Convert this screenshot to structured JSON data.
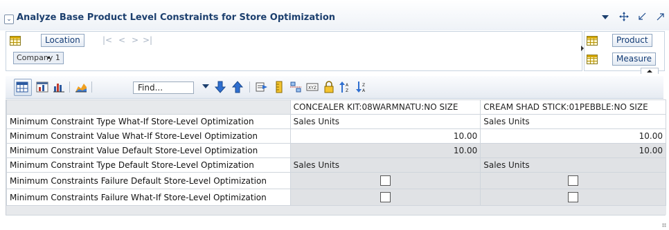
{
  "header": {
    "title": "Analyze Base Product Level Constraints for Store Optimization",
    "collapse_glyph": "⌄",
    "icons": [
      "dropdown-arrow-icon",
      "move-icon",
      "minimize-icon",
      "maximize-icon"
    ]
  },
  "pov": {
    "location_label": "Location",
    "nav_first": "|<",
    "nav_prev": "<",
    "nav_next": ">",
    "nav_last": ">|",
    "selected_member": "Company 1",
    "right_dims": [
      "Product",
      "Measure"
    ]
  },
  "toolbar": {
    "find_value": "Find...",
    "icons": [
      "spreadsheet-view-icon",
      "pivot-chart-icon",
      "bar-chart-icon",
      "area-chart-icon",
      "find-dropdown-icon",
      "find-next-icon",
      "find-previous-icon",
      "export-icon",
      "ruler-icon",
      "split-icon",
      "xyz-icon",
      "lock-icon",
      "sort-ascending-icon",
      "sort-descending-icon"
    ]
  },
  "table": {
    "columns": [
      "CONCEALER KIT:08WARMNATU:NO SIZE",
      "CREAM SHAD STICK:01PEBBLE:NO SIZE"
    ],
    "rows": [
      {
        "label": "Minimum Constraint Type What-If Store-Level Optimization",
        "values": [
          "Sales Units",
          "Sales Units"
        ],
        "kind": "text",
        "shade": "white"
      },
      {
        "label": "Minimum Constraint Value What-If Store-Level Optimization",
        "values": [
          "10.00",
          "10.00"
        ],
        "kind": "num",
        "shade": "white"
      },
      {
        "label": "Minimum Constraint Value Default Store-Level Optimization",
        "values": [
          "10.00",
          "10.00"
        ],
        "kind": "num",
        "shade": "grey"
      },
      {
        "label": "Minimum Constraint Type Default Store-Level Optimization",
        "values": [
          "Sales Units",
          "Sales Units"
        ],
        "kind": "text",
        "shade": "grey"
      },
      {
        "label": "Minimum Constraints Failure Default Store-Level Optimization",
        "values": [
          false,
          false
        ],
        "kind": "check",
        "shade": "grey"
      },
      {
        "label": "Minimum Constraints Failure What-If Store-Level Optimization",
        "values": [
          false,
          false
        ],
        "kind": "check",
        "shade": "grey"
      }
    ]
  },
  "colors": {
    "title": "#1c3f6e",
    "link": "#123b75",
    "toolbar_blue": "#2f6fd0",
    "grey_cell": "#e0e2e5"
  }
}
